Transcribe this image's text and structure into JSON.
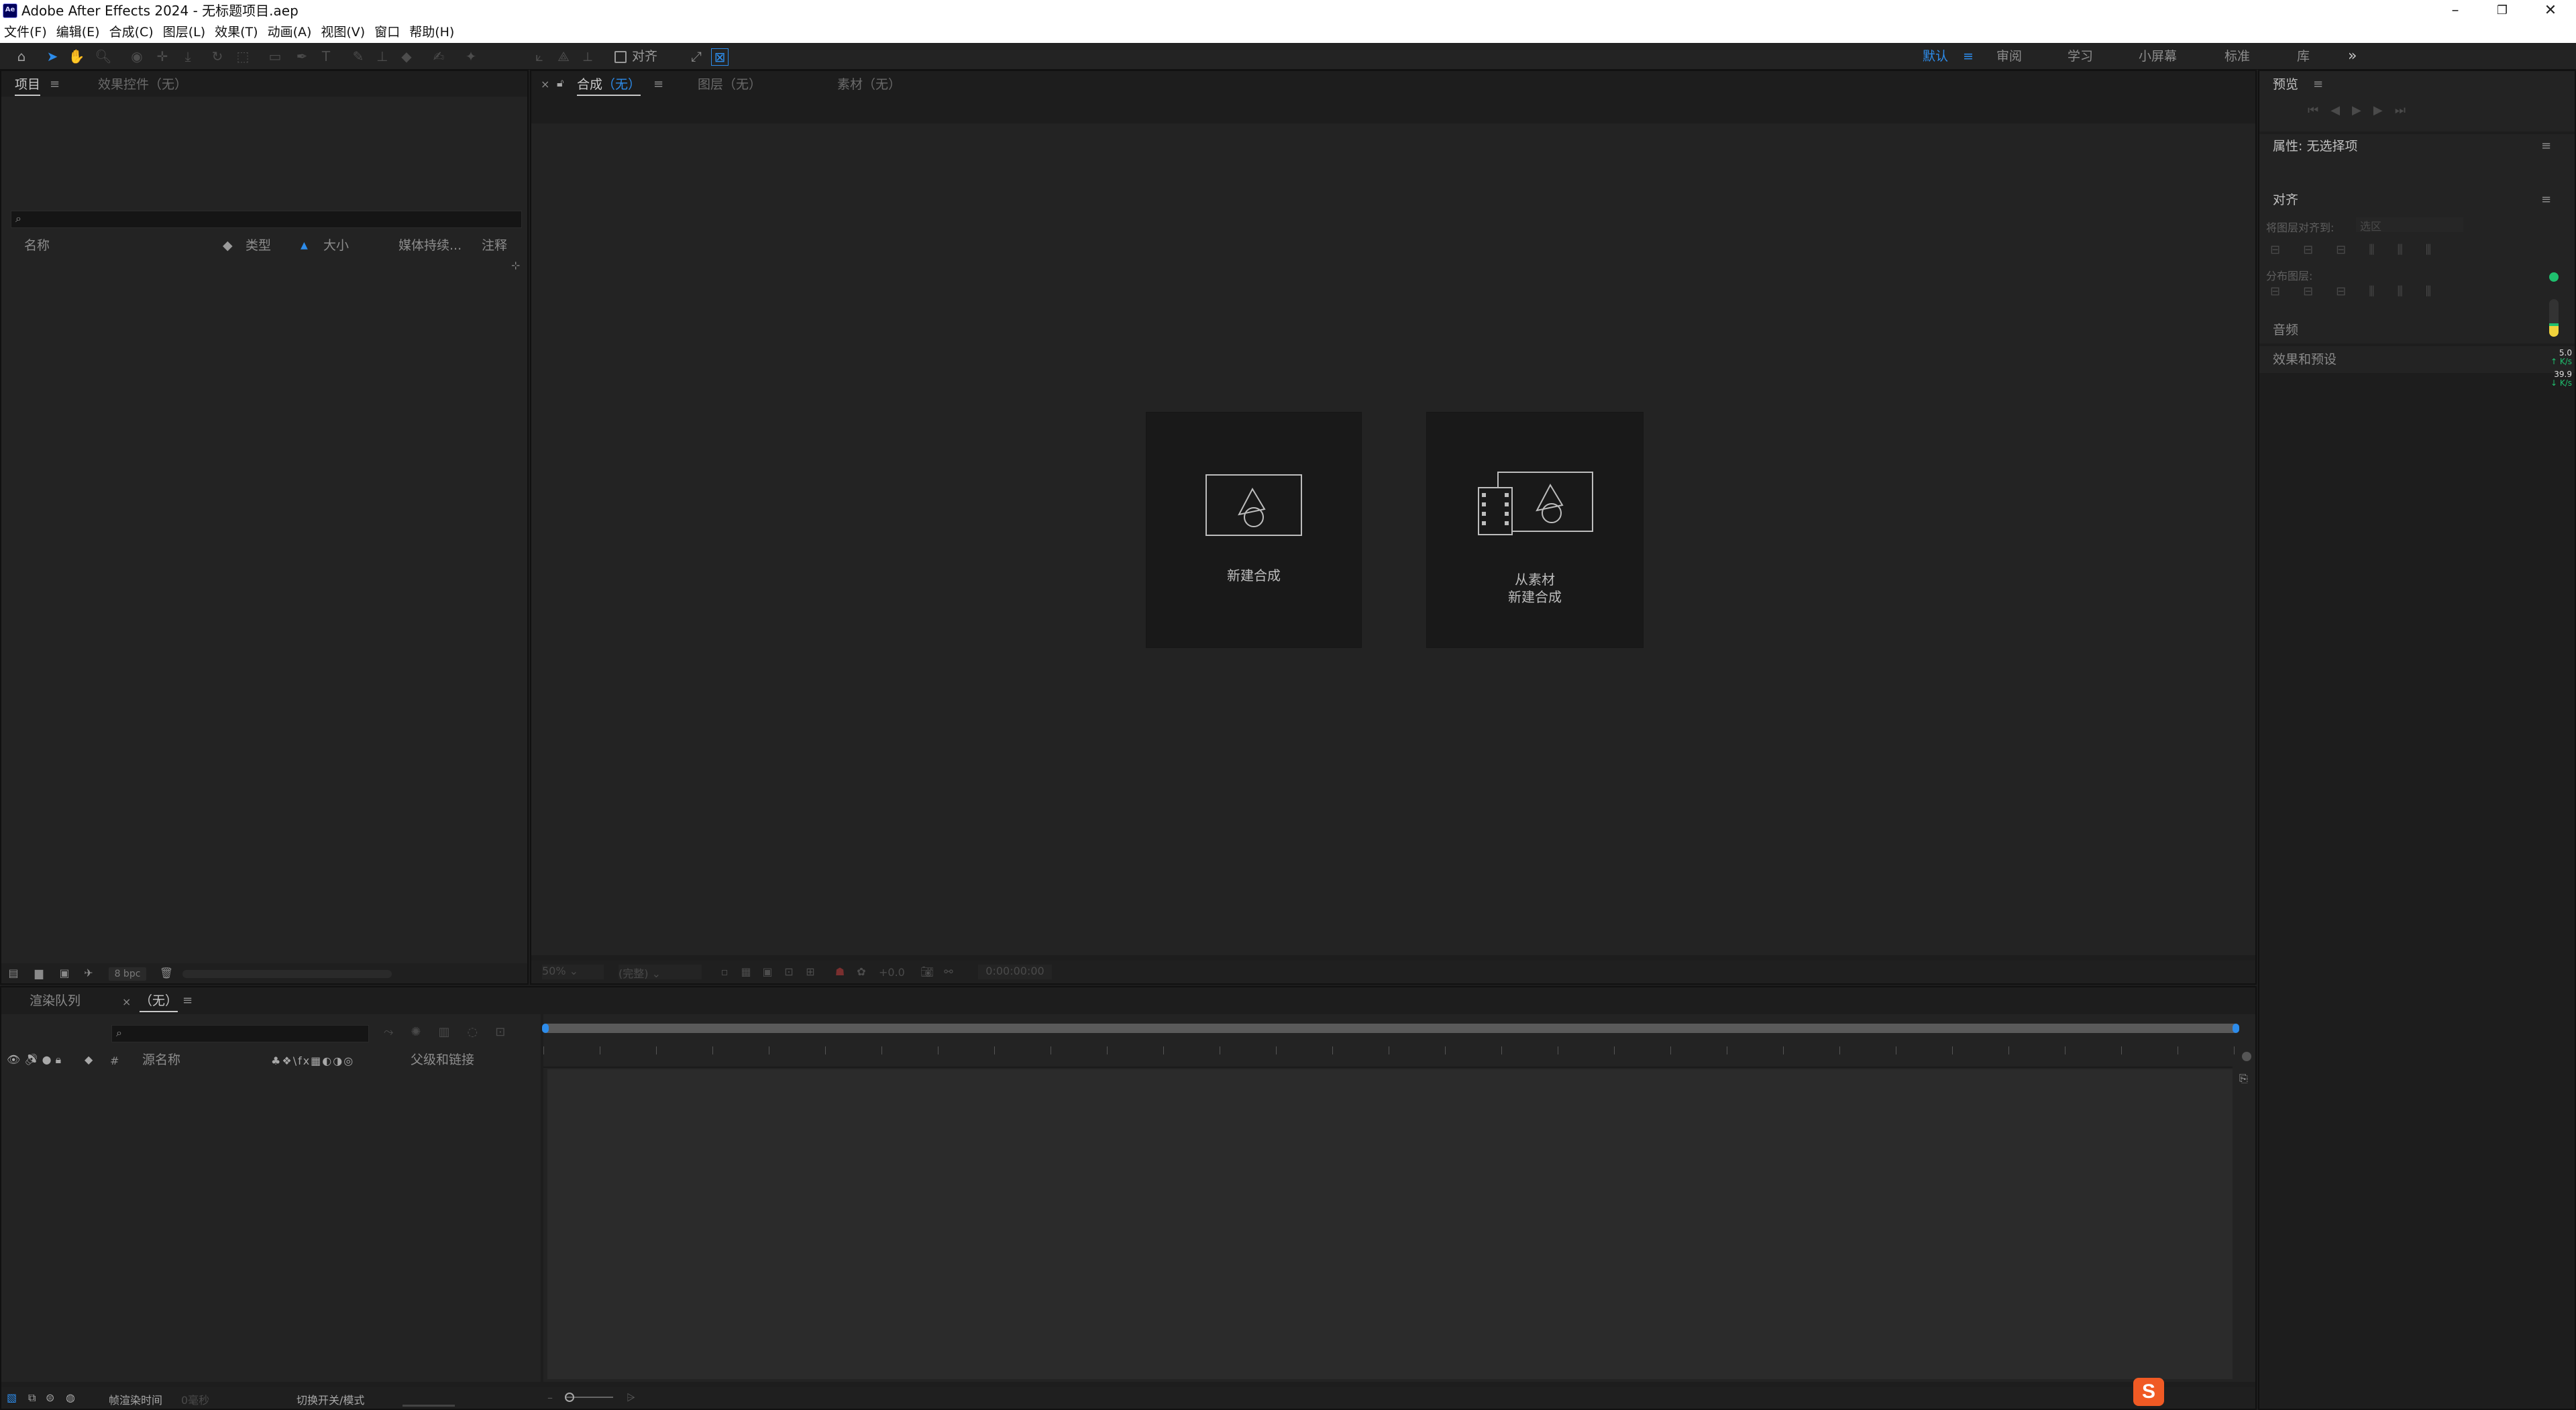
{
  "window": {
    "title": "Adobe After Effects 2024 - 无标题项目.aep",
    "app_badge": "Ae"
  },
  "menu": [
    "文件(F)",
    "编辑(E)",
    "合成(C)",
    "图层(L)",
    "效果(T)",
    "动画(A)",
    "视图(V)",
    "窗口",
    "帮助(H)"
  ],
  "toolbar": {
    "snap_label": "对齐"
  },
  "workspaces": {
    "items": [
      "默认",
      "审阅",
      "学习",
      "小屏幕",
      "标准",
      "库"
    ],
    "active": "默认",
    "more": "»"
  },
  "project_panel": {
    "tab_project": "项目",
    "tab_effects": "效果控件（无）",
    "columns": [
      "名称",
      "类型",
      "大小",
      "媒体持续...",
      "注释"
    ],
    "bpc": "8 bpc"
  },
  "comp_panel": {
    "close": "×",
    "tab_comp": "合成",
    "tab_comp_suffix": "（无）",
    "tab_layer": "图层（无）",
    "tab_footage": "素材（无）",
    "new_comp_label": "新建合成",
    "from_footage_line1": "从素材",
    "from_footage_line2": "新建合成",
    "footer_zoom": "50%",
    "footer_res": "(完整)",
    "footer_exposure": "+0.0",
    "footer_timecode": "0:00:00:00"
  },
  "right_panels": {
    "preview": "预览",
    "properties": "属性: 无选择项",
    "align": "对齐",
    "align_to": "将图层对齐到:",
    "align_to_value": "选区",
    "distribute": "分布图层:",
    "audio": "音频",
    "effects_presets": "效果和预设"
  },
  "meters": {
    "up_value": "5.0",
    "up_unit": "K/s",
    "down_value": "39.9",
    "down_unit": "K/s"
  },
  "timeline": {
    "tab_render": "渲染队列",
    "tab_comp": "（无）",
    "close": "×",
    "col_hash": "#",
    "col_source": "源名称",
    "col_parent": "父级和链接",
    "switches_icons": "♣❖\\fx▦◐◑◎"
  },
  "statusbar": {
    "frame_render_label": "帧渲染时间",
    "frame_render_value": "0毫秒",
    "toggle_label": "切换开关/模式"
  },
  "colors": {
    "accent": "#2d8ceb",
    "panel_bg": "#232323",
    "frame_bg": "#1d1d1d",
    "ime_badge": "#f05a24",
    "meter_green": "#1fbf6e"
  }
}
